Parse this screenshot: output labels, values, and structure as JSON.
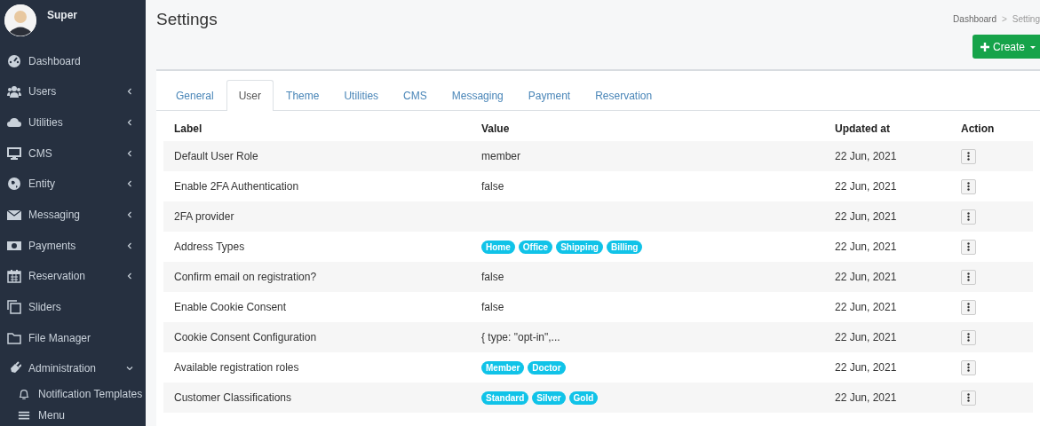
{
  "sidebar": {
    "user": {
      "name": "Super"
    },
    "items": [
      {
        "label": "Dashboard"
      },
      {
        "label": "Users",
        "expanded": false
      },
      {
        "label": "Utilities",
        "expanded": false
      },
      {
        "label": "CMS",
        "expanded": false
      },
      {
        "label": "Entity",
        "expanded": false
      },
      {
        "label": "Messaging",
        "expanded": false
      },
      {
        "label": "Payments",
        "expanded": false
      },
      {
        "label": "Reservation",
        "expanded": false
      },
      {
        "label": "Sliders"
      },
      {
        "label": "File Manager"
      },
      {
        "label": "Administration",
        "expanded": true,
        "children": [
          {
            "label": "Notification Templates"
          },
          {
            "label": "Menu"
          }
        ]
      }
    ]
  },
  "page": {
    "title": "Settings",
    "breadcrumb": [
      "Dashboard",
      "Setting"
    ],
    "breadcrumb_separator": ">",
    "create_button": "Create"
  },
  "tabs": [
    {
      "label": "General",
      "selected": false
    },
    {
      "label": "User",
      "selected": true
    },
    {
      "label": "Theme",
      "selected": false
    },
    {
      "label": "Utilities",
      "selected": false
    },
    {
      "label": "CMS",
      "selected": false
    },
    {
      "label": "Messaging",
      "selected": false
    },
    {
      "label": "Payment",
      "selected": false
    },
    {
      "label": "Reservation",
      "selected": false
    }
  ],
  "table": {
    "columns": [
      "Label",
      "Value",
      "Updated at",
      "Action"
    ],
    "rows": [
      {
        "label": "Default User Role",
        "value": "member",
        "updated": "22 Jun, 2021"
      },
      {
        "label": "Enable 2FA Authentication",
        "value": "false",
        "updated": "22 Jun, 2021"
      },
      {
        "label": "2FA provider",
        "updated": "22 Jun, 2021"
      },
      {
        "label": "Address Types",
        "tags": [
          "Home",
          "Office",
          "Shipping",
          "Billing"
        ],
        "updated": "22 Jun, 2021"
      },
      {
        "label": "Confirm email on registration?",
        "value": "false",
        "updated": "22 Jun, 2021"
      },
      {
        "label": "Enable Cookie Consent",
        "value": "false",
        "updated": "22 Jun, 2021"
      },
      {
        "label": "Cookie Consent Configuration",
        "value": "{ type: \"opt-in\",...",
        "updated": "22 Jun, 2021"
      },
      {
        "label": "Available registration roles",
        "tags": [
          "Member",
          "Doctor"
        ],
        "updated": "22 Jun, 2021"
      },
      {
        "label": "Customer Classifications",
        "tags": [
          "Standard",
          "Silver",
          "Gold"
        ],
        "updated": "22 Jun, 2021"
      }
    ]
  }
}
